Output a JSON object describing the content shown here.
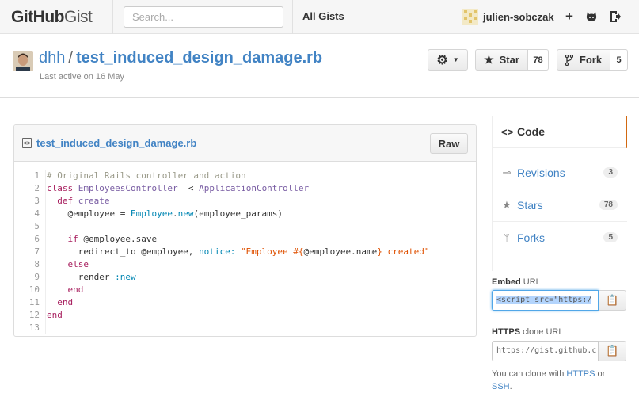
{
  "header": {
    "logo_github": "GitHub",
    "logo_gist": "Gist",
    "search_placeholder": "Search...",
    "all_gists": "All Gists",
    "username": "julien-sobczak"
  },
  "gist": {
    "owner": "dhh",
    "separator": "/",
    "filename": "test_induced_design_damage.rb",
    "last_active": "Last active on 16 May",
    "star_label": "Star",
    "star_count": "78",
    "fork_label": "Fork",
    "fork_count": "5"
  },
  "file": {
    "name": "test_induced_design_damage.rb",
    "raw_label": "Raw",
    "line_numbers": [
      "1",
      "2",
      "3",
      "4",
      "5",
      "6",
      "7",
      "8",
      "9",
      "10",
      "11",
      "12",
      "13"
    ]
  },
  "sidebar": {
    "nav": [
      {
        "label": "Code",
        "icon": "code-icon",
        "count": ""
      },
      {
        "label": "Revisions",
        "icon": "revisions-icon",
        "count": "3"
      },
      {
        "label": "Stars",
        "icon": "star-icon",
        "count": "78"
      },
      {
        "label": "Forks",
        "icon": "fork-icon",
        "count": "5"
      }
    ],
    "embed_label": "Embed",
    "embed_suffix": "URL",
    "embed_value": "<script src=\"https:/",
    "https_label": "HTTPS",
    "https_suffix": "clone URL",
    "https_value": "https://gist.github.c",
    "clone_prefix": "You can clone with",
    "clone_https": "HTTPS",
    "clone_or": "or",
    "clone_ssh": "SSH",
    "clone_end": "."
  },
  "colors": {
    "link": "#4183c4",
    "active_border": "#d26911",
    "keyword": "#a71d5d",
    "string": "#df5000",
    "constant": "#0086b3"
  }
}
